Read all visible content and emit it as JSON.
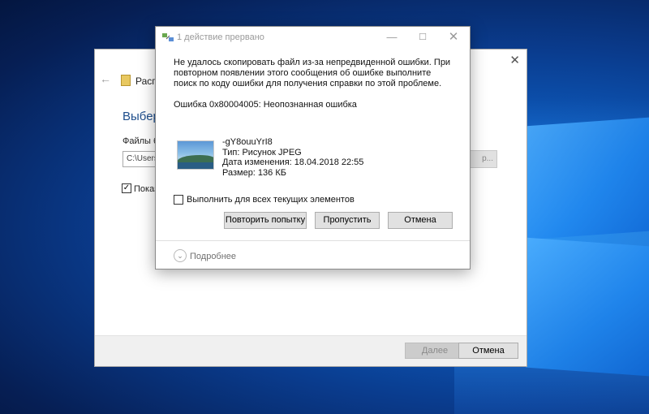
{
  "background_window": {
    "title": "Распа",
    "heading": "Выбер",
    "files_label": "Файлы б",
    "path_value": "C:\\Users",
    "browse_label": "р...",
    "checkbox_label": "Показ",
    "checkbox_checked": true,
    "next_label": "Далее",
    "cancel_label": "Отмена"
  },
  "dialog": {
    "title": "1 действие прервано",
    "message": "Не удалось скопировать файл из-за непредвиденной ошибки. При повторном появлении этого сообщения об ошибке выполните поиск по коду ошибки для получения справки по этой проблеме.",
    "error_line": "Ошибка 0x80004005: Неопознанная ошибка",
    "file": {
      "name": "-gY8ouuYrI8",
      "type": "Тип: Рисунок JPEG",
      "modified": "Дата изменения: 18.04.2018 22:55",
      "size": "Размер: 136 КБ"
    },
    "apply_all_label": "Выполнить для всех текущих элементов",
    "apply_all_checked": false,
    "buttons": {
      "retry": "Повторить попытку",
      "skip": "Пропустить",
      "cancel": "Отмена"
    },
    "more_details": "Подробнее"
  },
  "icons": {
    "title_icon": "transfer-icon",
    "minimize": "minimize-icon",
    "maximize": "maximize-icon",
    "close": "close-icon",
    "more": "chevron-down-icon"
  }
}
